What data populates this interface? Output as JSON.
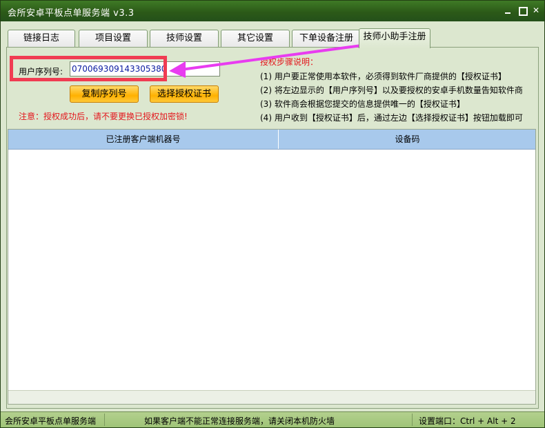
{
  "window": {
    "title": "会所安卓平板点单服务端 v3.3"
  },
  "tabs": [
    {
      "label": "链接日志"
    },
    {
      "label": "项目设置"
    },
    {
      "label": "技师设置"
    },
    {
      "label": "其它设置"
    },
    {
      "label": "下单设备注册"
    },
    {
      "label": "技师小助手注册"
    }
  ],
  "register": {
    "serial_label": "用户序列号:",
    "serial_value": "070069309143305380",
    "copy_button": "复制序列号",
    "choose_button": "选择授权证书",
    "warning": "注意：授权成功后，请不要更换已授权加密锁!"
  },
  "steps": {
    "title": "授权步骤说明：",
    "items": [
      "(1) 用户要正常使用本软件，必须得到软件厂商提供的【授权证书】",
      "(2) 将左边显示的【用户序列号】以及要授权的安卓手机数量告知软件商",
      "(3) 软件商会根据您提交的信息提供唯一的【授权证书】",
      "(4) 用户收到【授权证书】后，通过左边【选择授权证书】按钮加载即可"
    ]
  },
  "table": {
    "columns": [
      "已注册客户端机器号",
      "设备码"
    ]
  },
  "statusbar": {
    "left": "会所安卓平板点单服务端",
    "middle": "如果客户端不能正常连接服务端，请关闭本机防火墙",
    "right": "设置端口：Ctrl + Alt + 2"
  },
  "colors": {
    "highlight": "#f03c52",
    "arrow": "#e83cf0",
    "accent": "#2c5a18"
  }
}
